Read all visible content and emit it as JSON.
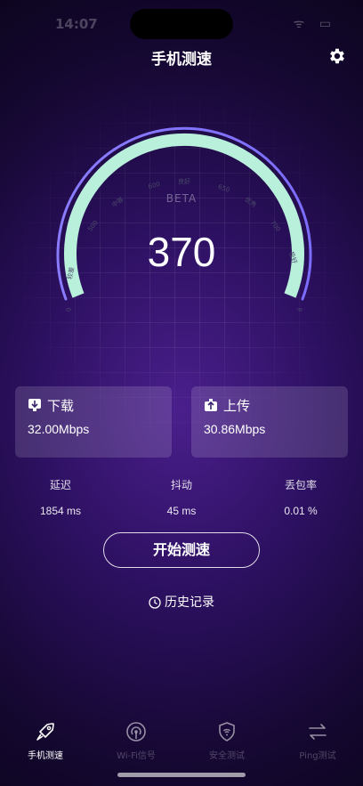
{
  "status": {
    "time": "14:07",
    "icons": "ᯤ ▭"
  },
  "header": {
    "title": "手机测速"
  },
  "gauge": {
    "value": "370",
    "badge": "BETA",
    "ticks": [
      {
        "num": "250",
        "label": "较差"
      },
      {
        "num": "500",
        "label": "中等"
      },
      {
        "num": "600",
        "label": "良好"
      },
      {
        "num": "650",
        "label": "优秀"
      },
      {
        "num": "700",
        "label": "极好"
      },
      {
        "num": "950",
        "label": ""
      }
    ],
    "colors": {
      "arc": "#b8f0dc",
      "outer": "#8a7cff"
    }
  },
  "download": {
    "label": "下载",
    "value": "32.00Mbps"
  },
  "upload": {
    "label": "上传",
    "value": "30.86Mbps"
  },
  "metrics": [
    {
      "label": "延迟",
      "value": "1854 ms"
    },
    {
      "label": "抖动",
      "value": "45 ms"
    },
    {
      "label": "丢包率",
      "value": "0.01 %"
    }
  ],
  "actions": {
    "start": "开始测速",
    "history": "历史记录"
  },
  "tabs": [
    {
      "label": "手机测速",
      "icon": "rocket-icon",
      "active": true
    },
    {
      "label": "Wi-Fi信号",
      "icon": "signal-icon",
      "active": false
    },
    {
      "label": "安全测试",
      "icon": "shield-wifi-icon",
      "active": false
    },
    {
      "label": "Ping测试",
      "icon": "arrows-icon",
      "active": false
    }
  ]
}
